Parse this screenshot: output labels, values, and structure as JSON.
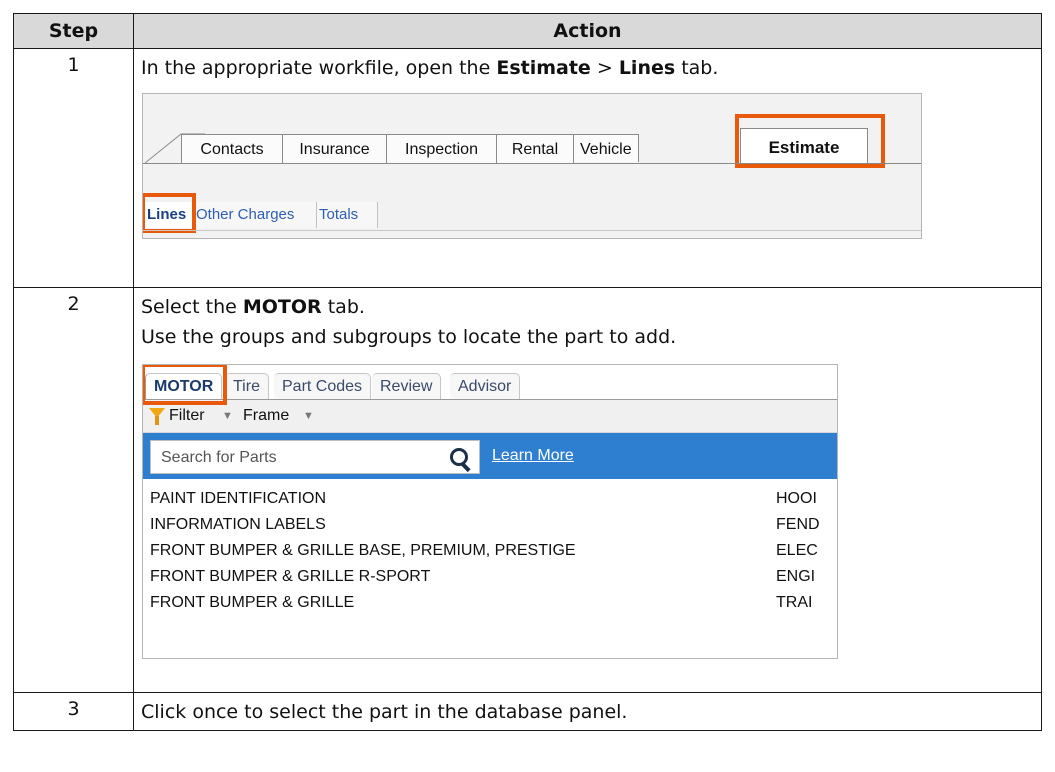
{
  "header": {
    "step": "Step",
    "action": "Action"
  },
  "steps": [
    {
      "num": "1",
      "text_before": "In the appropriate workfile, open the ",
      "bold1": "Estimate",
      "sep": " > ",
      "bold2": "Lines",
      "text_after": " tab."
    },
    {
      "num": "2",
      "line1_before": "Select the ",
      "line1_bold": "MOTOR",
      "line1_after": " tab.",
      "line2": "Use the groups and subgroups to locate the part to add."
    },
    {
      "num": "3",
      "text": "Click once to select the part in the database panel."
    }
  ],
  "shot1": {
    "tabs": [
      "Contacts",
      "Insurance",
      "Inspection",
      "Rental",
      "Vehicle",
      "Estimate"
    ],
    "active_tab": "Estimate",
    "subtabs": [
      "Lines",
      "Other Charges",
      "Totals"
    ],
    "active_subtab": "Lines"
  },
  "shot2": {
    "tabs": [
      "MOTOR",
      "Tire",
      "Part Codes",
      "Review",
      "Advisor"
    ],
    "active_tab": "MOTOR",
    "filter_label": "Filter",
    "frame_label": "Frame",
    "search_placeholder": "Search for Parts",
    "learn_more": "Learn More",
    "parts": [
      "PAINT IDENTIFICATION",
      "INFORMATION LABELS",
      "FRONT BUMPER & GRILLE BASE, PREMIUM, PRESTIGE",
      "FRONT BUMPER & GRILLE R-SPORT",
      "FRONT BUMPER & GRILLE"
    ],
    "parts_col2": [
      "HOOI",
      "FEND",
      "ELEC",
      "ENGI",
      "TRAI"
    ]
  },
  "colors": {
    "highlight": "#e8590c",
    "search_bar": "#2f7fd0"
  }
}
